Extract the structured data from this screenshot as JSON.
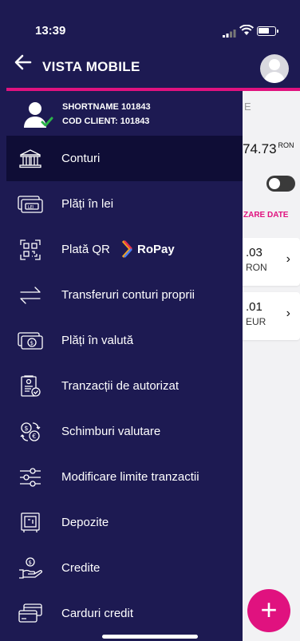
{
  "status_bar": {
    "time": "13:39"
  },
  "header": {
    "title": "VISTA MOBILE",
    "back_icon": "arrow-left-icon"
  },
  "user": {
    "shortname": "SHORTNAME 101843",
    "client_code": "COD CLIENT: 101843"
  },
  "menu": [
    {
      "label": "Conturi",
      "icon": "bank-icon",
      "active": true
    },
    {
      "label": "Plăți în lei",
      "icon": "lei-banknote-icon"
    },
    {
      "label": "Plată QR",
      "icon": "qr-code-icon",
      "badge": "RoPay"
    },
    {
      "label": "Transferuri conturi proprii",
      "icon": "transfer-arrows-icon"
    },
    {
      "label": "Plăți în valută",
      "icon": "dollar-banknote-icon"
    },
    {
      "label": "Tranzacții de autorizat",
      "icon": "document-check-icon"
    },
    {
      "label": "Schimburi valutare",
      "icon": "currency-exchange-icon"
    },
    {
      "label": "Modificare limite tranzactii",
      "icon": "sliders-icon"
    },
    {
      "label": "Depozite",
      "icon": "safe-icon"
    },
    {
      "label": "Credite",
      "icon": "hand-coin-icon"
    },
    {
      "label": "Carduri credit",
      "icon": "credit-cards-icon"
    }
  ],
  "background": {
    "fragment_e": "E",
    "balance": "74.73",
    "balance_currency": "RON",
    "sync_label": "ZARE DATE",
    "accounts": [
      {
        "amount": ".03",
        "currency": "RON"
      },
      {
        "amount": ".01",
        "currency": "EUR"
      }
    ],
    "fab_label": "+"
  },
  "colors": {
    "navy": "#1d1a52",
    "accent": "#e0127f",
    "active": "#0f0d36"
  }
}
